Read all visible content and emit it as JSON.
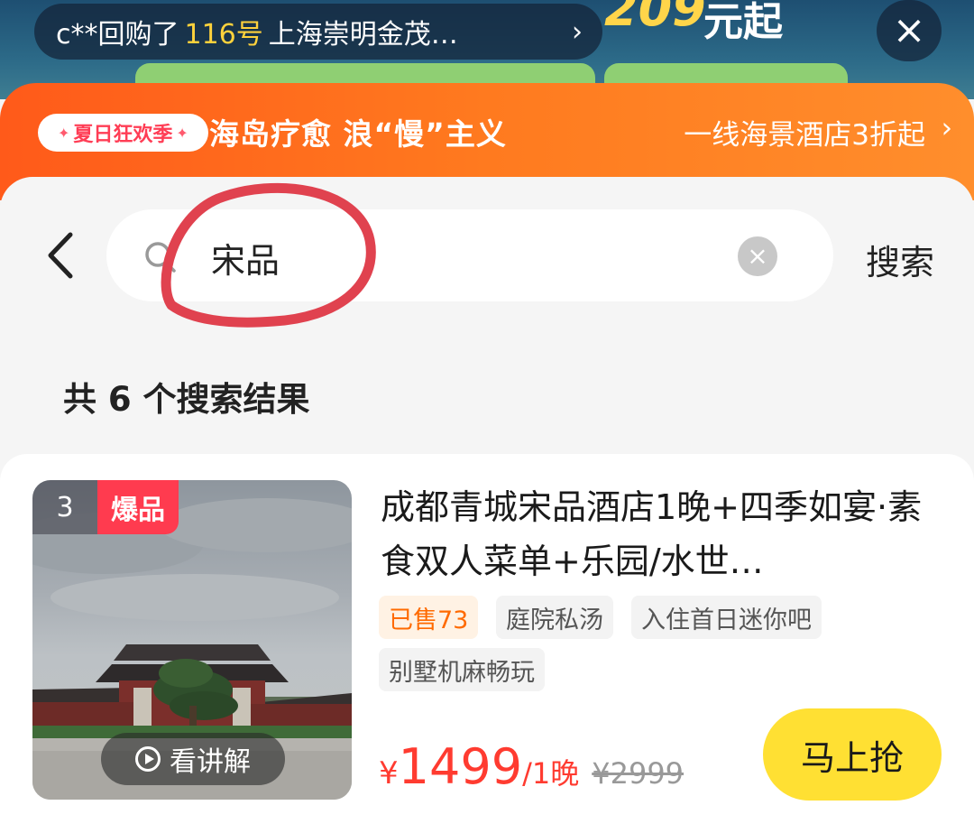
{
  "ticker": {
    "user": "c**回购了",
    "number": "116号",
    "hotel": "上海崇明金茂…",
    "chevron": "›"
  },
  "banner_background": {
    "headline_partial": "209",
    "headline_suffix": "元起"
  },
  "close_label": "×",
  "promo": {
    "badge": "夏日狂欢季",
    "slogan": "海岛疗愈 浪“慢”主义",
    "link": "一线海景酒店3折起",
    "chevron": "›"
  },
  "search": {
    "value": "宋品",
    "clear_label": "×",
    "button_label": "搜索"
  },
  "results": {
    "count_text": "共 6 个搜索结果"
  },
  "product": {
    "rank": "3",
    "hot_label": "爆品",
    "explain_label": "看讲解",
    "title": "成都青城宋品酒店1晚+四季如宴·素食双人菜单+乐园/水世…",
    "tags": [
      "已售73",
      "庭院私汤",
      "入住首日迷你吧",
      "别墅机麻畅玩"
    ],
    "price_symbol": "¥",
    "price": "1499",
    "price_unit": "/1晚",
    "original_price": "¥2999",
    "buy_label": "马上抢"
  },
  "colors": {
    "accent_orange": "#ff6a1f",
    "price_red": "#ff3b30",
    "buy_yellow": "#ffe033",
    "annotation_red": "#e0424f"
  },
  "icons": {
    "back": "chevron-left-icon",
    "search": "magnifier-icon",
    "clear": "close-circle-icon",
    "play": "play-circle-icon"
  }
}
